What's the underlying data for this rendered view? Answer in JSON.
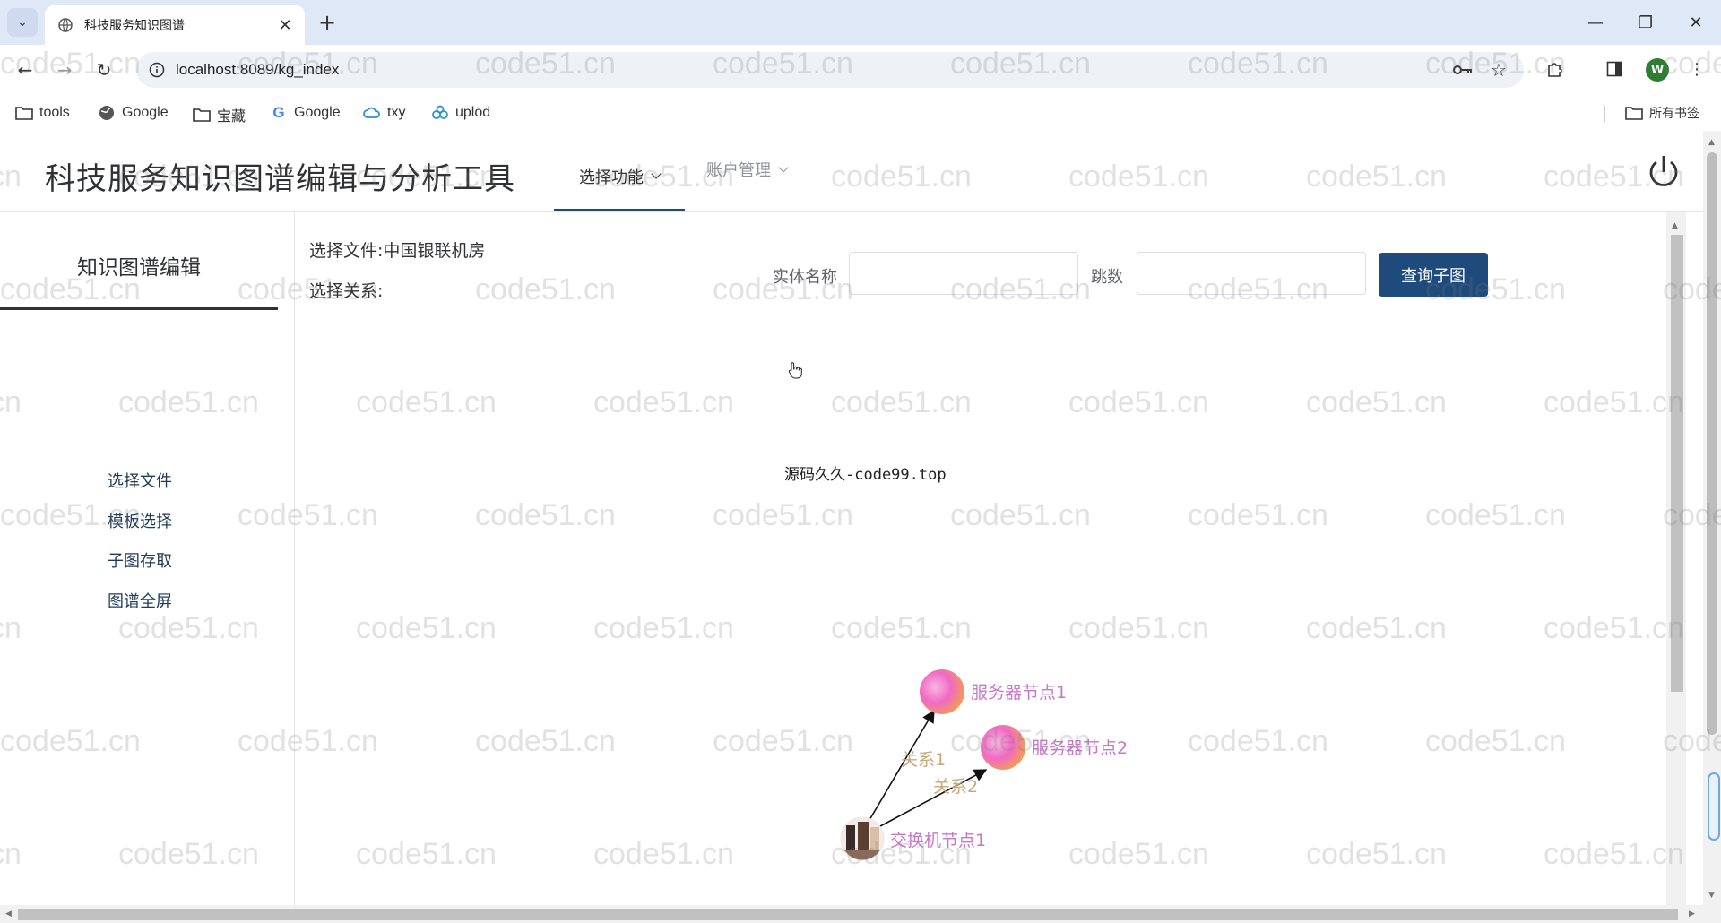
{
  "browser": {
    "tab_title": "科技服务知识图谱",
    "url": "localhost:8089/kg_index",
    "bookmarks": [
      {
        "label": "tools",
        "icon": "folder-icon"
      },
      {
        "label": "Google",
        "icon": "globe-icon"
      },
      {
        "label": "宝藏",
        "icon": "folder-icon"
      },
      {
        "label": "Google",
        "icon": "google-icon"
      },
      {
        "label": "txy",
        "icon": "cloud-icon"
      },
      {
        "label": "uplod",
        "icon": "uplod-icon"
      }
    ],
    "all_bookmarks": "所有书签",
    "profile_initial": "W"
  },
  "app": {
    "title": "科技服务知识图谱编辑与分析工具",
    "menu": [
      {
        "label": "选择功能",
        "active": true
      },
      {
        "label": "账户管理",
        "active": false
      }
    ]
  },
  "sidebar": {
    "title": "知识图谱编辑",
    "items": [
      "选择文件",
      "模板选择",
      "子图存取",
      "图谱全屏"
    ]
  },
  "main": {
    "selected_file": "选择文件:中国银联机房",
    "selected_relation": "选择关系:",
    "entity_label": "实体名称",
    "entity_value": "",
    "hops_label": "跳数",
    "hops_value": "",
    "query_button": "查询子图",
    "source_text": "源码久久-code99.top"
  },
  "graph": {
    "nodes": [
      {
        "id": "n1",
        "label": "服务器节点1"
      },
      {
        "id": "n2",
        "label": "服务器节点2"
      },
      {
        "id": "n3",
        "label": "交换机节点1"
      }
    ],
    "edges": [
      {
        "from": "n3",
        "to": "n1",
        "label": "关系1"
      },
      {
        "from": "n3",
        "to": "n2",
        "label": "关系2"
      }
    ],
    "node_label_color": "#c678c8",
    "edge_label_color": "#c8a878"
  },
  "watermark": "code51.cn",
  "colors": {
    "accent": "#1f4a7c",
    "tabbar": "#dfe8f7"
  }
}
